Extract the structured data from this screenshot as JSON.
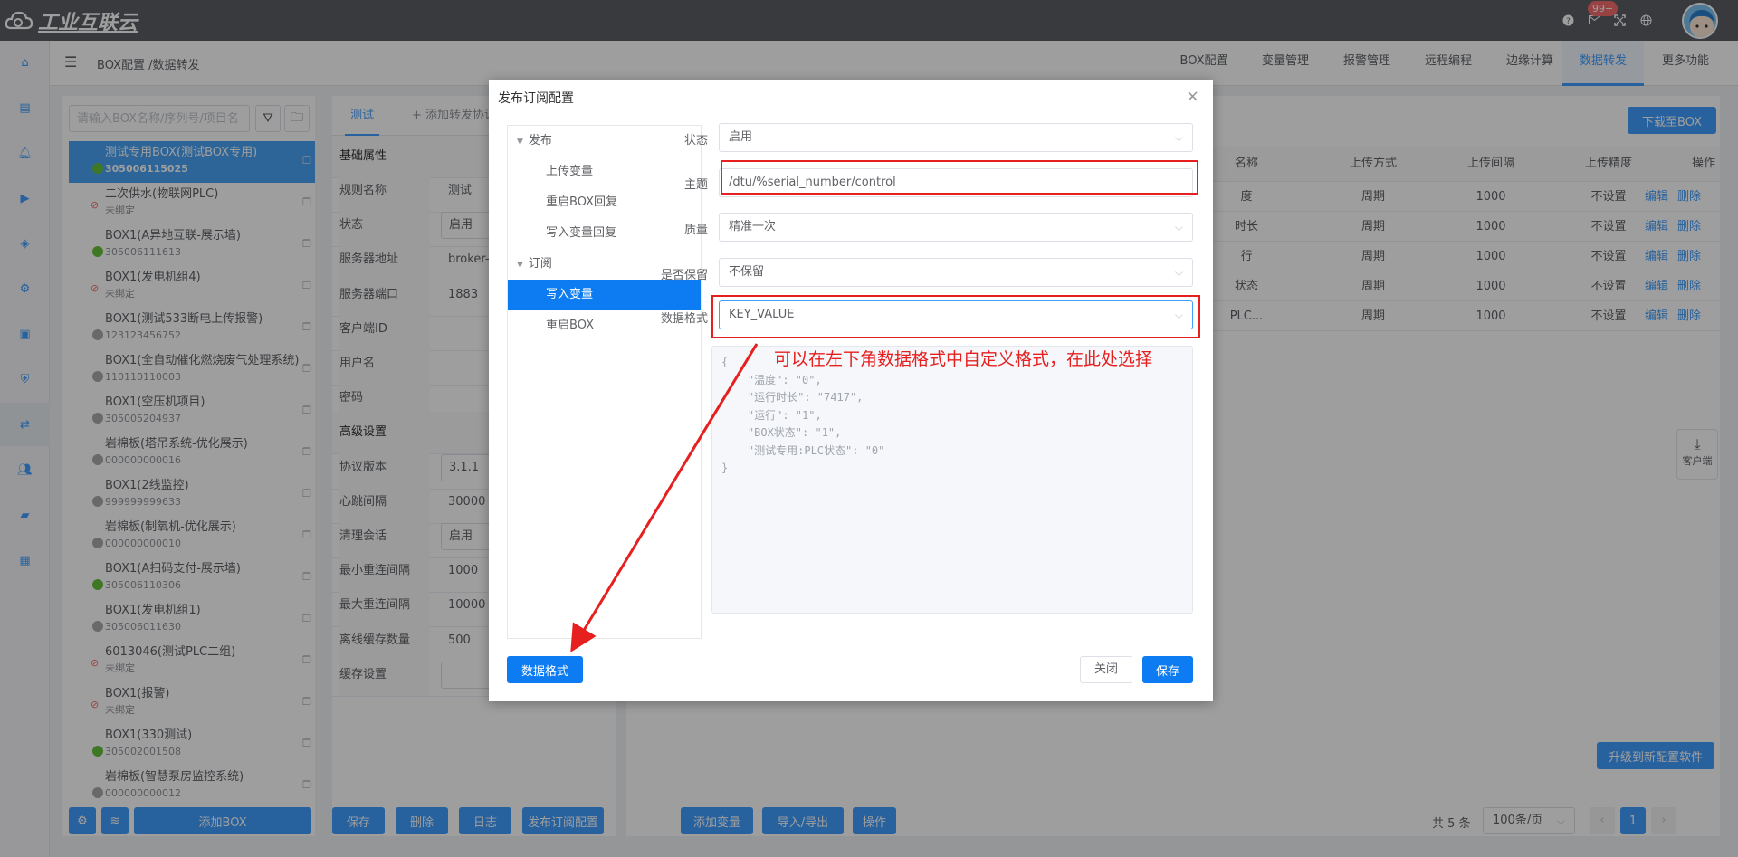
{
  "app": {
    "logo_text": "工业互联云",
    "badge": "99+"
  },
  "header": {
    "breadcrumb": "BOX配置 /数据转发",
    "tabs": [
      "BOX配置",
      "变量管理",
      "报警管理",
      "远程编程",
      "边缘计算",
      "数据转发",
      "更多功能"
    ],
    "active_tab": "数据转发"
  },
  "left": {
    "search_placeholder": "请输入BOX名称/序列号/项目名",
    "items": [
      {
        "name": "测试专用BOX(测试BOX专用)",
        "serial": "305006115025",
        "status": "online",
        "selected": true
      },
      {
        "name": "二次供水(物联网PLC)",
        "serial": "未绑定",
        "status": "unbound"
      },
      {
        "name": "BOX1(A异地互联-展示墙)",
        "serial": "305006111613",
        "status": "online"
      },
      {
        "name": "BOX1(发电机组4)",
        "serial": "未绑定",
        "status": "unbound"
      },
      {
        "name": "BOX1(测试533断电上传报警)",
        "serial": "123123456752",
        "status": "offline"
      },
      {
        "name": "BOX1(全自动催化燃烧废气处理系统)",
        "serial": "110110110003",
        "status": "offline"
      },
      {
        "name": "BOX1(空压机项目)",
        "serial": "305005204937",
        "status": "offline"
      },
      {
        "name": "岩棉板(塔吊系统-优化展示)",
        "serial": "000000000016",
        "status": "offline"
      },
      {
        "name": "BOX1(2线监控)",
        "serial": "999999999633",
        "status": "offline"
      },
      {
        "name": "岩棉板(制氧机-优化展示)",
        "serial": "000000000010",
        "status": "offline"
      },
      {
        "name": "BOX1(A扫码支付-展示墙)",
        "serial": "305006110306",
        "status": "online"
      },
      {
        "name": "BOX1(发电机组1)",
        "serial": "305006011630",
        "status": "offline"
      },
      {
        "name": "6013046(测试PLC二组)",
        "serial": "未绑定",
        "status": "unbound"
      },
      {
        "name": "BOX1(报警)",
        "serial": "未绑定",
        "status": "unbound"
      },
      {
        "name": "BOX1(330测试)",
        "serial": "305002001508",
        "status": "online"
      },
      {
        "name": "岩棉板(智慧泵房监控系统)",
        "serial": "000000000012",
        "status": "offline"
      }
    ],
    "add_box": "添加BOX"
  },
  "mid": {
    "tab_active": "测试",
    "tab_add": "+ 添加转发协议",
    "basic_section": "基础属性",
    "advanced_section": "高级设置",
    "rows": [
      {
        "label": "规则名称",
        "value": "测试",
        "box": false
      },
      {
        "label": "状态",
        "value": "启用",
        "box": true
      },
      {
        "label": "服务器地址",
        "value": "broker-c",
        "box": false
      },
      {
        "label": "服务器端口",
        "value": "1883",
        "box": false
      },
      {
        "label": "客户端ID",
        "value": "",
        "box": false
      },
      {
        "label": "用户名",
        "value": "",
        "box": false
      },
      {
        "label": "密码",
        "value": "",
        "box": false
      }
    ],
    "adv_rows": [
      {
        "label": "协议版本",
        "value": "3.1.1",
        "box": true
      },
      {
        "label": "心跳间隔",
        "value": "30000",
        "box": false
      },
      {
        "label": "清理会话",
        "value": "启用",
        "box": true
      },
      {
        "label": "最小重连间隔",
        "value": "1000",
        "box": false
      },
      {
        "label": "最大重连间隔",
        "value": "10000",
        "box": false
      },
      {
        "label": "离线缓存数量",
        "value": "500",
        "box": false
      },
      {
        "label": "缓存设置",
        "value": "",
        "box": true
      }
    ],
    "buttons": [
      "保存",
      "删除",
      "日志",
      "发布订阅配置"
    ]
  },
  "right": {
    "download_btn": "下载至BOX",
    "columns": [
      "名称",
      "上传方式",
      "上传间隔",
      "上传精度",
      "操作"
    ],
    "rows": [
      {
        "name": "度",
        "mode": "周期",
        "interval": "1000",
        "precision": "不设置"
      },
      {
        "name": "时长",
        "mode": "周期",
        "interval": "1000",
        "precision": "不设置"
      },
      {
        "name": "行",
        "mode": "周期",
        "interval": "1000",
        "precision": "不设置"
      },
      {
        "name": "状态",
        "mode": "周期",
        "interval": "1000",
        "precision": "不设置"
      },
      {
        "name": "PLC...",
        "mode": "周期",
        "interval": "1000",
        "precision": "不设置"
      }
    ],
    "edit": "编辑",
    "delete": "删除",
    "client_label": "客户端",
    "upgrade_btn": "升级到新配置软件",
    "bottom_buttons": [
      "添加变量",
      "导入/导出",
      "操作"
    ],
    "total": "共 5 条",
    "page_size": "100条/页",
    "page": "1"
  },
  "dialog": {
    "title": "发布订阅配置",
    "tree": {
      "publish": "发布",
      "publish_items": [
        "上传变量",
        "重启BOX回复",
        "写入变量回复"
      ],
      "subscribe": "订阅",
      "subscribe_items": [
        "写入变量",
        "重启BOX"
      ],
      "selected": "写入变量"
    },
    "fields": {
      "status_label": "状态",
      "status_value": "启用",
      "topic_label": "主题",
      "topic_value": "/dtu/%serial_number/control",
      "quality_label": "质量",
      "quality_value": "精准一次",
      "retain_label": "是否保留",
      "retain_value": "不保留",
      "format_label": "数据格式",
      "format_value": "KEY_VALUE"
    },
    "json_preview": "{\n    \"温度\": \"0\",\n    \"运行时长\": \"7417\",\n    \"运行\": \"1\",\n    \"BOX状态\": \"1\",\n    \"测试专用:PLC状态\": \"0\"\n}",
    "annotation": "可以在左下角数据格式中自定义格式，在此处选择",
    "format_btn": "数据格式",
    "close_btn": "关闭",
    "save_btn": "保存",
    "annotation_color": "#e61f1f"
  }
}
